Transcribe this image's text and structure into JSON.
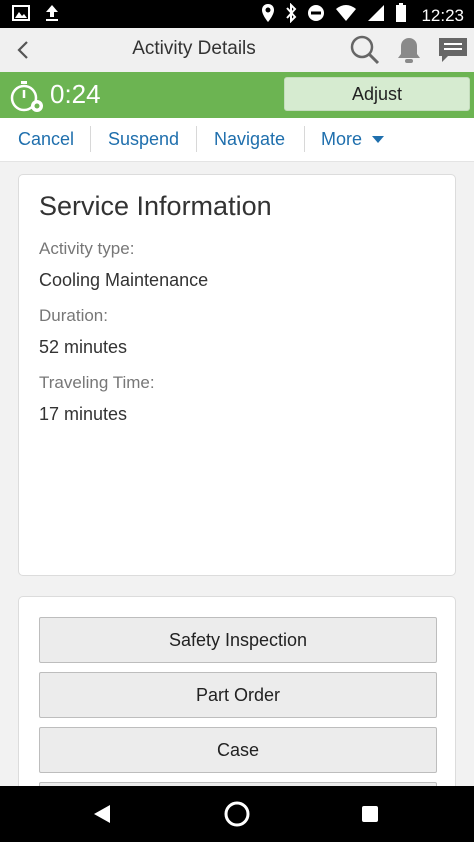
{
  "status_bar": {
    "time": "12:23"
  },
  "header": {
    "title": "Activity Details"
  },
  "timer": {
    "elapsed": "0:24",
    "adjust_label": "Adjust"
  },
  "actions": {
    "cancel": "Cancel",
    "suspend": "Suspend",
    "navigate": "Navigate",
    "more": "More"
  },
  "service_info": {
    "title": "Service Information",
    "fields": [
      {
        "label": "Activity type:",
        "value": "Cooling Maintenance"
      },
      {
        "label": "Duration:",
        "value": "52 minutes"
      },
      {
        "label": "Traveling Time:",
        "value": "17 minutes"
      }
    ]
  },
  "links": [
    {
      "label": "Safety Inspection"
    },
    {
      "label": "Part Order"
    },
    {
      "label": "Case"
    }
  ],
  "colors": {
    "accent_green": "#6cb452",
    "link_blue": "#1f6fad",
    "adjust_bg": "#d6ebd0"
  }
}
